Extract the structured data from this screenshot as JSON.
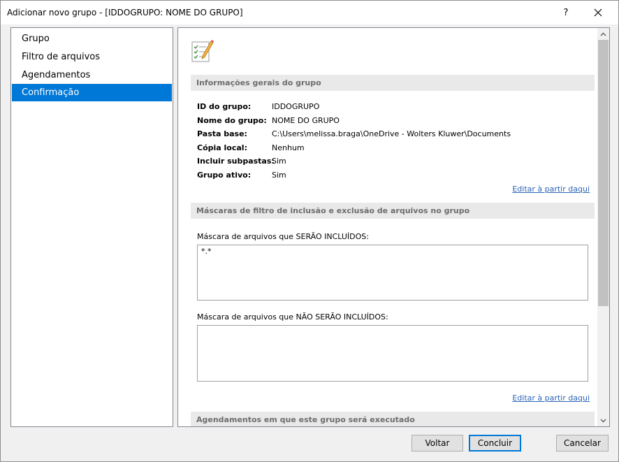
{
  "window": {
    "title": "Adicionar novo grupo - [IDDOGRUPO: NOME DO GRUPO]",
    "help_label": "?",
    "close_icon": "close-icon"
  },
  "sidebar": {
    "items": [
      {
        "label": "Grupo",
        "selected": false
      },
      {
        "label": "Filtro de arquivos",
        "selected": false
      },
      {
        "label": "Agendamentos",
        "selected": false
      },
      {
        "label": "Confirmação",
        "selected": true
      }
    ],
    "selected_color": "#0078d7"
  },
  "content": {
    "icon": "checklist-pencil-icon",
    "general_section": {
      "title": "Informações gerais do grupo",
      "rows": [
        {
          "label": "ID do grupo:",
          "value": "IDDOGRUPO"
        },
        {
          "label": "Nome do grupo:",
          "value": "NOME DO GRUPO"
        },
        {
          "label": "Pasta base:",
          "value": "C:\\Users\\melissa.braga\\OneDrive - Wolters Kluwer\\Documents"
        },
        {
          "label": "Cópia local:",
          "value": "Nenhum"
        },
        {
          "label": "Incluir subpastas:",
          "value": "Sim"
        },
        {
          "label": "Grupo ativo:",
          "value": "Sim"
        }
      ],
      "edit_link": "Editar à partir daqui"
    },
    "mask_section": {
      "title": "Máscaras de filtro de inclusão e exclusão de arquivos no grupo",
      "include_label": "Máscara de arquivos que SERÃO INCLUÍDOS:",
      "include_value": "*.*",
      "exclude_label": "Máscara de arquivos que NÃO SERÃO INCLUÍDOS:",
      "exclude_value": "",
      "edit_link": "Editar à partir daqui"
    },
    "schedule_section": {
      "title": "Agendamentos em que este grupo será executado"
    }
  },
  "footer": {
    "back_label": "Voltar",
    "finish_label": "Concluir",
    "cancel_label": "Cancelar"
  }
}
